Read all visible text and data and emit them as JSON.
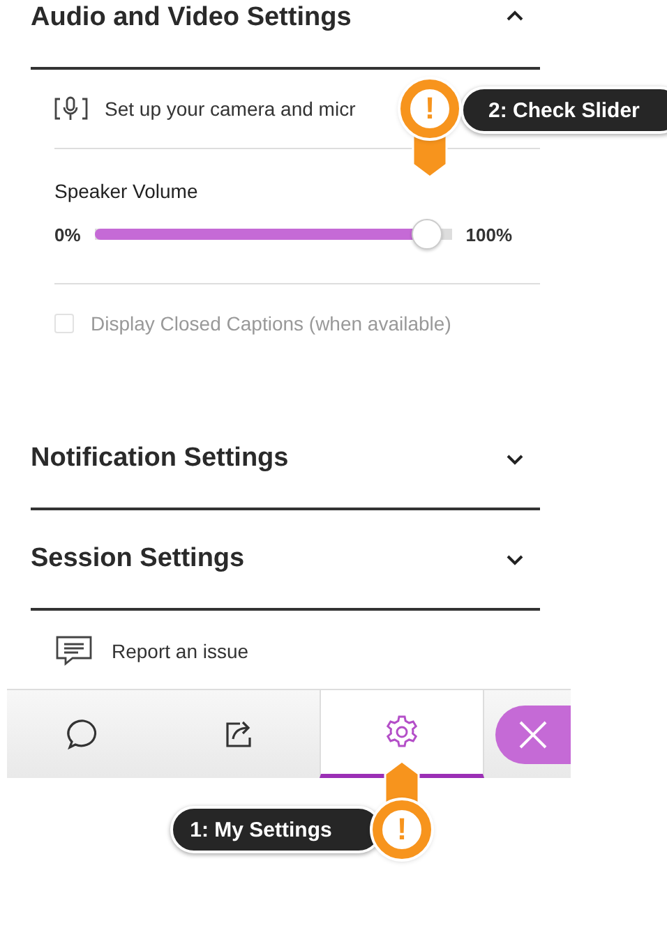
{
  "sections": [
    {
      "title": "Audio and Video Settings",
      "expanded": true,
      "items": [
        {
          "kind": "link",
          "text": "Set up your camera and micr"
        },
        {
          "kind": "slider",
          "label": "Speaker Volume",
          "min_label": "0%",
          "max_label": "100%",
          "level": 0.97
        },
        {
          "kind": "checkbox",
          "text": "Display Closed Captions (when available)",
          "checked": false,
          "disabled": true
        }
      ]
    },
    {
      "title": "Notification Settings",
      "expanded": false
    },
    {
      "title": "Session Settings",
      "expanded": false
    }
  ],
  "report": {
    "text": "Report an issue"
  },
  "tabs": [
    {
      "kind": "chat",
      "selected": false
    },
    {
      "kind": "share",
      "selected": false
    },
    {
      "kind": "settings",
      "selected": true
    }
  ],
  "callouts": [
    {
      "kind": "down",
      "mark": "!",
      "text": "2: Check Slider"
    },
    {
      "kind": "up",
      "mark": "!",
      "text": "1: My Settings"
    }
  ]
}
